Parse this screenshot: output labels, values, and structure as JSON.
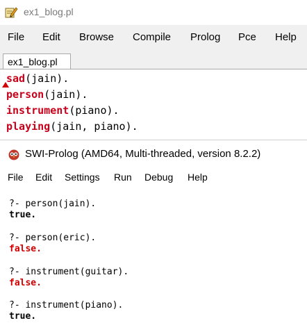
{
  "editor": {
    "window_title": "ex1_blog.pl",
    "menu": [
      "File",
      "Edit",
      "Browse",
      "Compile",
      "Prolog",
      "Pce",
      "Help"
    ],
    "tab_label": "ex1_blog.pl",
    "code_lines": [
      {
        "pred": "sad",
        "args": "(jain)."
      },
      {
        "pred": "person",
        "args": "(jain)."
      },
      {
        "pred": "instrument",
        "args": "(piano)."
      },
      {
        "pred": "playing",
        "args": "(jain, piano)."
      }
    ],
    "pred_color": "#c8001a"
  },
  "console": {
    "window_title": "SWI-Prolog (AMD64, Multi-threaded, version 8.2.2)",
    "menu": [
      "File",
      "Edit",
      "Settings",
      "Run",
      "Debug",
      "Help"
    ],
    "entries": [
      {
        "query": "?- person(jain).",
        "answer": "true."
      },
      {
        "query": "?- person(eric).",
        "answer": "false."
      },
      {
        "query": "?- instrument(guitar).",
        "answer": "false."
      },
      {
        "query": "?- instrument(piano).",
        "answer": "true."
      }
    ],
    "false_color": "#d00000"
  },
  "icons": {
    "editor_icon": "pencil-notepad-icon",
    "prolog_icon": "swi-prolog-owl-icon"
  }
}
